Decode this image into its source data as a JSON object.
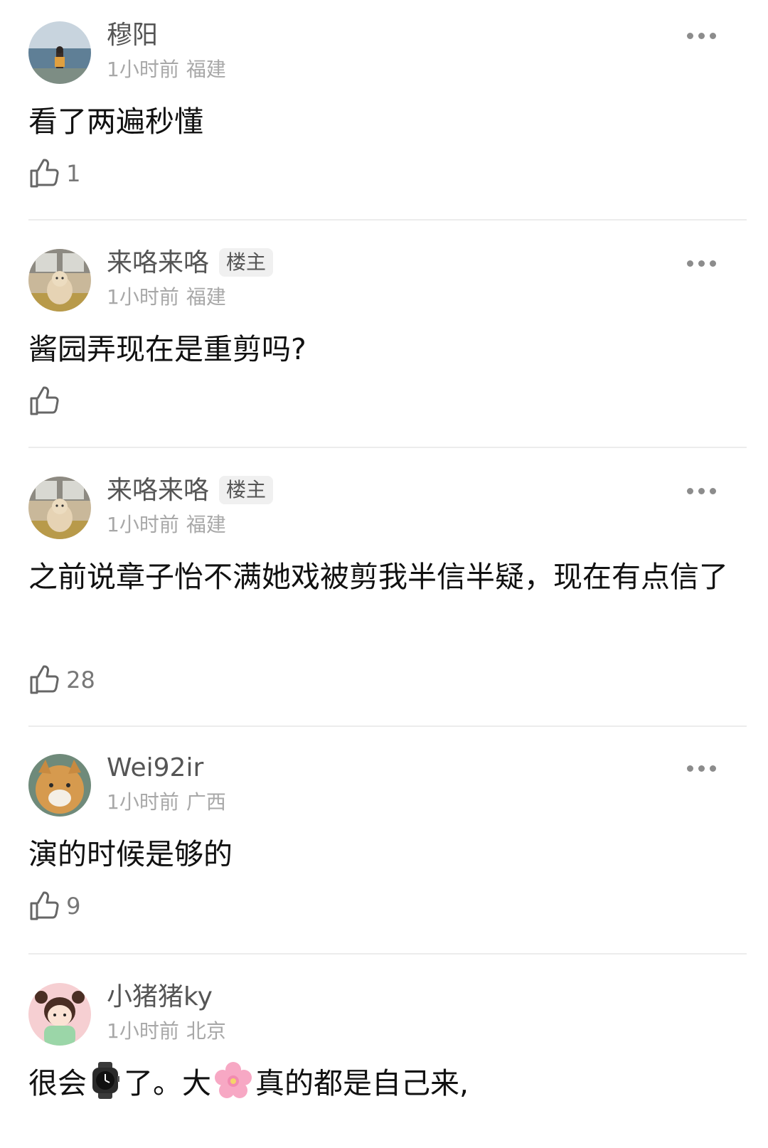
{
  "comments": [
    {
      "username": "穆阳",
      "op_badge": "",
      "time": "1小时前",
      "location": "福建",
      "text": "看了两遍秒懂",
      "likes": "1"
    },
    {
      "username": "来咯来咯",
      "op_badge": "楼主",
      "time": "1小时前",
      "location": "福建",
      "text": "酱园弄现在是重剪吗?",
      "likes": ""
    },
    {
      "username": "来咯来咯",
      "op_badge": "楼主",
      "time": "1小时前",
      "location": "福建",
      "text": "之前说章子怡不满她戏被剪我半信半疑，现在有点信了",
      "likes": "28"
    },
    {
      "username": "Wei92ir",
      "op_badge": "",
      "time": "1小时前",
      "location": "广西",
      "text": "演的时候是够的",
      "likes": "9"
    },
    {
      "username": "小猪猪ky",
      "op_badge": "",
      "time": "1小时前",
      "location": "北京",
      "text_parts": [
        "很会",
        "了。大",
        "真的都是自己来,"
      ],
      "emojis": [
        "watch-emoji",
        "cherry-blossom-emoji"
      ],
      "likes": ""
    }
  ],
  "icons": {
    "more": "more-dots-icon",
    "like": "thumbs-up-icon"
  },
  "colors": {
    "username": "#555555",
    "meta": "#a8a8a8",
    "body_text": "#111111",
    "badge_bg": "#f0f0f0",
    "divider": "#ececec"
  }
}
